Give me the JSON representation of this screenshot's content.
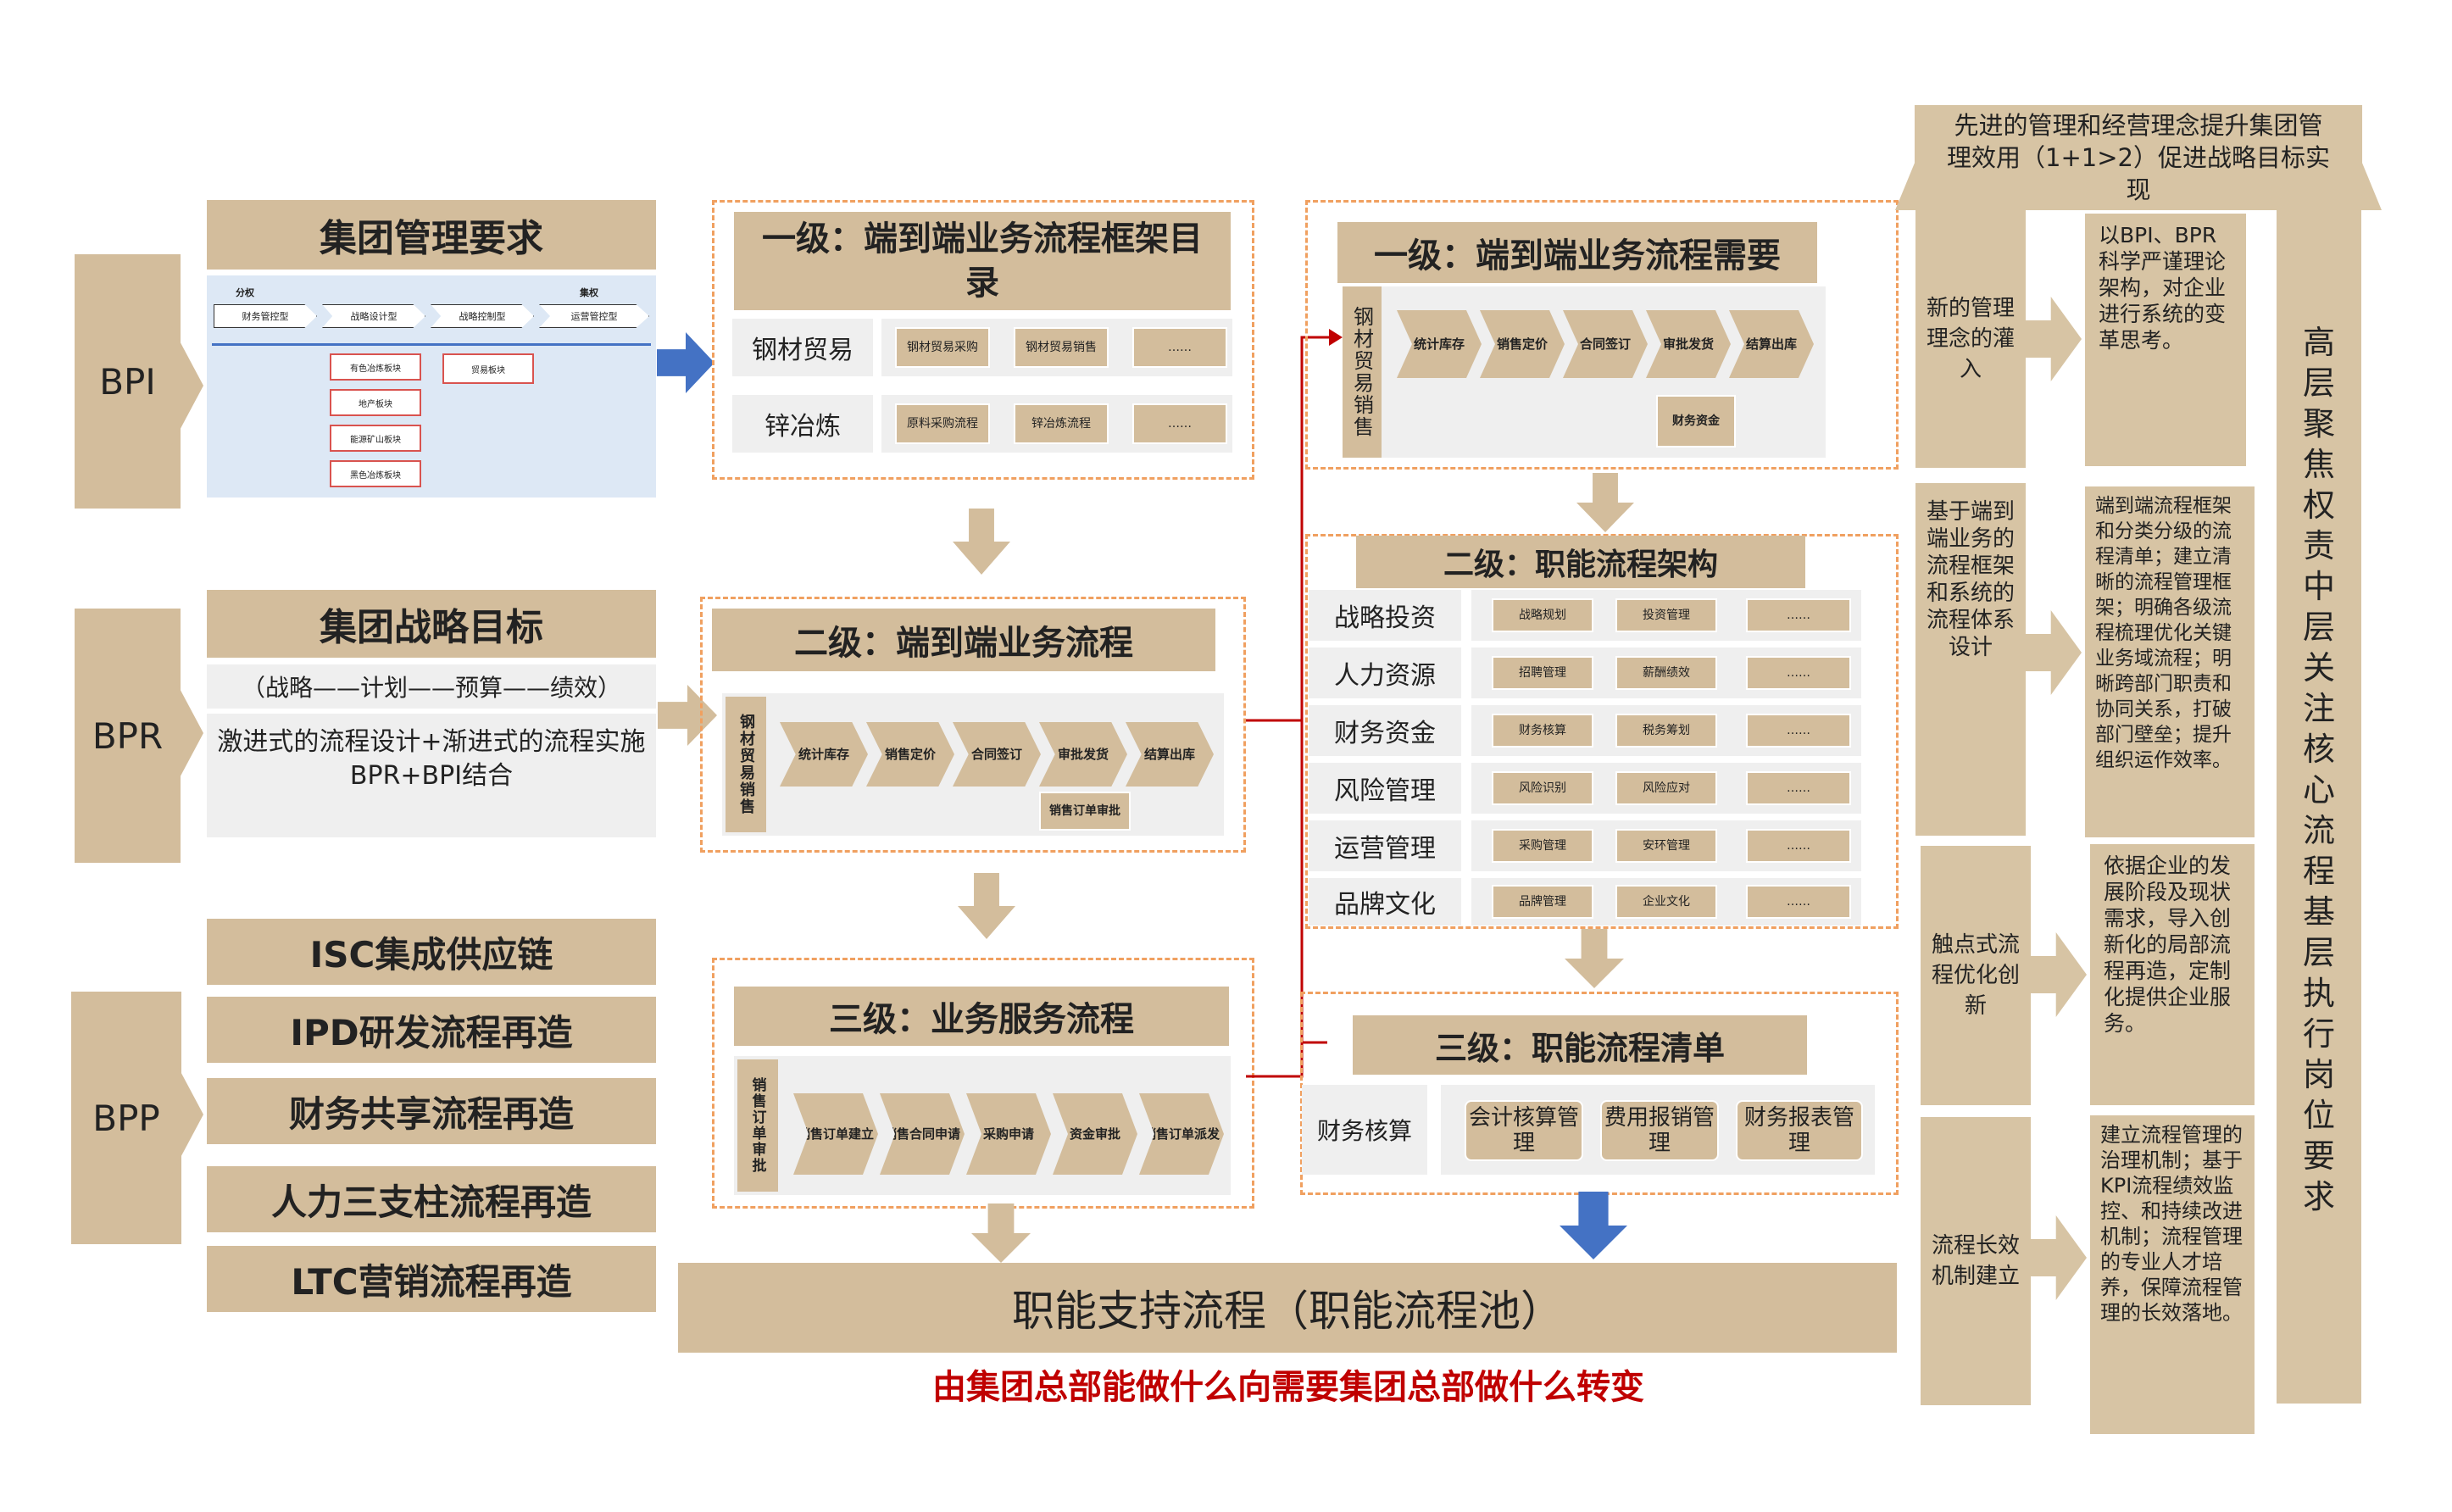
{
  "left": {
    "bpi_tab": "BPI",
    "bpr_tab": "BPR",
    "bpp_tab": "BPP",
    "group_mgmt_title": "集团管理要求",
    "mini": {
      "top_left": "分权",
      "top_right": "集权",
      "chevrons": [
        "财务管控型",
        "战略设计型",
        "战略控制型",
        "运营管控型"
      ],
      "boxes": [
        "有色冶炼板块",
        "地产板块",
        "能源矿山板块",
        "黑色冶炼板块",
        "贸易板块"
      ]
    },
    "strategy_title": "集团战略目标",
    "strategy_chain": "（战略——计划——预算——绩效）",
    "strategy_desc": "激进式的流程设计+渐进式的流程实施",
    "strategy_desc2": "BPR+BPI结合",
    "bpp_items": [
      "ISC集成供应链",
      "IPD研发流程再造",
      "财务共享流程再造",
      "人力三支柱流程再造",
      "LTC营销流程再造"
    ]
  },
  "mid": {
    "l1_title": "一级：端到端业务流程框架目录",
    "l1_rows": [
      {
        "label": "钢材贸易",
        "chips": [
          "钢材贸易采购",
          "钢材贸易销售",
          "……"
        ]
      },
      {
        "label": "锌冶炼",
        "chips": [
          "原料采购流程",
          "锌冶炼流程",
          "……"
        ]
      }
    ],
    "l2_title": "二级：端到端业务流程",
    "l2_side": "钢材贸易销售",
    "l2_steps": [
      "统计库存",
      "销售定价",
      "合同签订",
      "审批发货",
      "结算出库"
    ],
    "l2_sub": "销售订单审批",
    "l3_title": "三级：业务服务流程",
    "l3_side": "销售订单审批",
    "l3_steps": [
      "销售订单建立",
      "销售合同申请",
      "采购申请",
      "资金审批",
      "销售订单派发"
    ],
    "bottom_bar": "职能支持流程（职能流程池）",
    "bottom_caption": "由集团总部能做什么向需要集团总部做什么转变"
  },
  "right": {
    "r1_title": "一级：端到端业务流程需要",
    "r1_side": "钢材贸易销售",
    "r1_steps": [
      "统计库存",
      "销售定价",
      "合同签订",
      "审批发货",
      "结算出库"
    ],
    "r1_sub": "财务资金",
    "r2_title": "二级：职能流程架构",
    "r2_rows": [
      {
        "label": "战略投资",
        "chips": [
          "战略规划",
          "投资管理",
          "……"
        ]
      },
      {
        "label": "人力资源",
        "chips": [
          "招聘管理",
          "薪酬绩效",
          "……"
        ]
      },
      {
        "label": "财务资金",
        "chips": [
          "财务核算",
          "税务筹划",
          "……"
        ]
      },
      {
        "label": "风险管理",
        "chips": [
          "风险识别",
          "风险应对",
          "……"
        ]
      },
      {
        "label": "运营管理",
        "chips": [
          "采购管理",
          "安环管理",
          "……"
        ]
      },
      {
        "label": "品牌文化",
        "chips": [
          "品牌管理",
          "企业文化",
          "……"
        ]
      }
    ],
    "r3_title": "三级：职能流程清单",
    "r3_label": "财务核算",
    "r3_chips": [
      "会计核算管理",
      "费用报销管理",
      "财务报表管理"
    ]
  },
  "far": {
    "top_banner": "先进的管理和经营理念提升集团管理效用（1+1>2）促进战略目标实现",
    "rows": [
      {
        "head": "新的管理理念的灌入",
        "body": "以BPI、BPR科学严谨理论架构，对企业进行系统的变革思考。"
      },
      {
        "head": "基于端到端业务的流程框架和系统的流程体系设计",
        "body": "端到端流程框架和分类分级的流程清单；建立清晰的流程管理框架；明确各级流程梳理优化关键业务域流程；明晰跨部门职责和协同关系，打破部门壁垒；提升组织运作效率。"
      },
      {
        "head": "触点式流程优化创新",
        "body": "依据企业的发展阶段及现状需求，导入创新化的局部流程再造，定制化提供企业服务。"
      },
      {
        "head": "流程长效机制建立",
        "body": "建立流程管理的治理机制；基于KPI流程绩效监控、和持续改进机制；流程管理的专业人才培养，保障流程管理的长效落地。"
      }
    ],
    "column": "高层聚焦权责 中层关注核心流程 基层执行岗位要求"
  },
  "colors": {
    "tan": "#d3bd9c",
    "dash": "#f0a060",
    "blue_arrow": "#4472c4",
    "red": "#c00000"
  }
}
